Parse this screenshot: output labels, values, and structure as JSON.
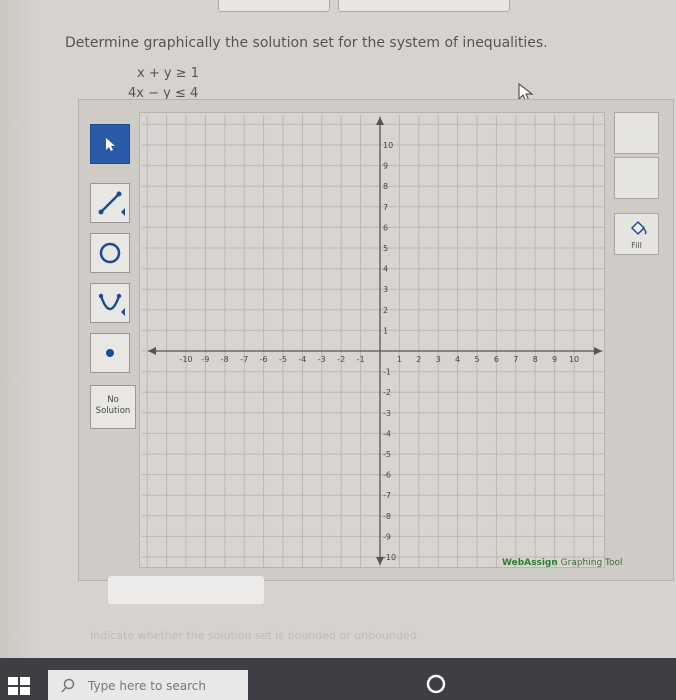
{
  "question": {
    "title": "Determine graphically the solution set for the system of inequalities.",
    "ineq1": "x + y ≥ 1",
    "ineq2": "4x − y ≤ 4"
  },
  "tools": {
    "no_solution_label": "No Solution",
    "fill_label": "Fill"
  },
  "graph": {
    "x_ticks": [
      "-10",
      "-9",
      "-8",
      "-7",
      "-6",
      "-5",
      "-4",
      "-3",
      "-2",
      "-1",
      "1",
      "2",
      "3",
      "4",
      "5",
      "6",
      "7",
      "8",
      "9",
      "10"
    ],
    "y_ticks": [
      "10",
      "9",
      "8",
      "7",
      "6",
      "5",
      "4",
      "3",
      "2",
      "1",
      "-1",
      "-2",
      "-3",
      "-4",
      "-5",
      "-6",
      "-7",
      "-8",
      "-9",
      "-10"
    ],
    "xlim": [
      -10,
      10
    ],
    "ylim": [
      -10,
      10
    ]
  },
  "branding": {
    "brand": "WebAssign",
    "suffix": "Graphing Tool"
  },
  "footer": {
    "indicate": "Indicate whether the solution set is bounded or unbounded."
  },
  "taskbar": {
    "search_placeholder": "Type here to search"
  }
}
